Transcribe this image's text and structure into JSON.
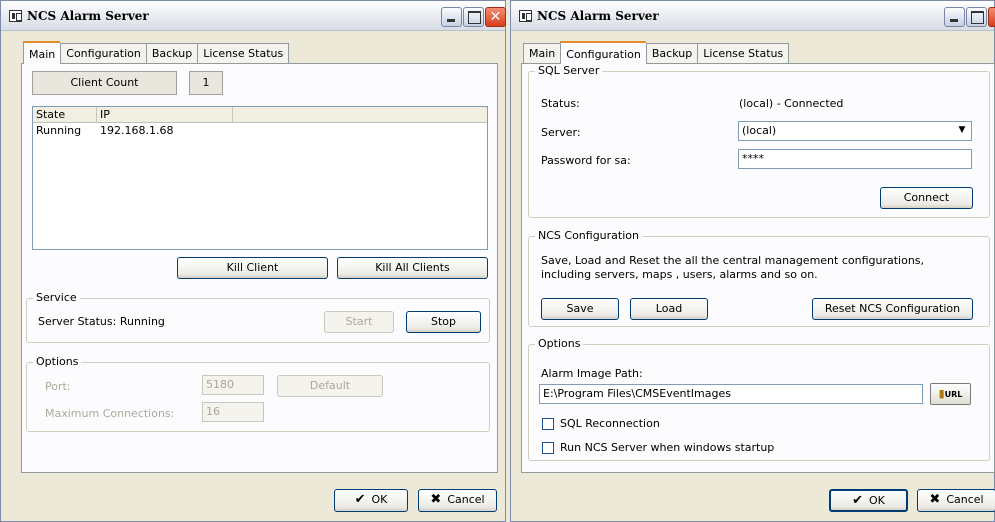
{
  "left_window": {
    "title": "NCS Alarm Server",
    "tabs": [
      "Main",
      "Configuration",
      "Backup",
      "License Status"
    ],
    "client_count_label": "Client Count",
    "client_count_value": "1",
    "list_headers": [
      "State",
      "IP"
    ],
    "list_rows": [
      [
        "Running",
        "192.168.1.68"
      ]
    ],
    "kill_client": "Kill Client",
    "kill_all_clients": "Kill All Clients",
    "service_legend": "Service",
    "server_status": "Server Status: Running",
    "start": "Start",
    "stop": "Stop",
    "options_legend": "Options",
    "port_label": "Port:",
    "port_value": "5180",
    "default": "Default",
    "max_conn_label": "Maximum Connections:",
    "max_conn_value": "16",
    "ok": "OK",
    "cancel": "Cancel"
  },
  "right_window": {
    "title": "NCS Alarm Server",
    "tabs": [
      "Main",
      "Configuration",
      "Backup",
      "License Status"
    ],
    "sql_legend": "SQL Server",
    "status_label": "Status:",
    "status_value": "(local) - Connected",
    "server_label": "Server:",
    "server_value": "(local)",
    "password_label": "Password for sa:",
    "password_value": "****",
    "connect": "Connect",
    "ncs_legend": "NCS Configuration",
    "ncs_desc": "Save, Load and Reset the all the central management configurations, including servers, maps , users, alarms and so on.",
    "save": "Save",
    "load": "Load",
    "reset": "Reset NCS Configuration",
    "options_legend": "Options",
    "alarm_path_label": "Alarm Image Path:",
    "alarm_path_value": "E:\\Program Files\\CMSEventImages",
    "url_btn": "URL",
    "sql_reconnection": "SQL Reconnection",
    "run_ncs": "Run NCS Server when windows startup",
    "ok": "OK",
    "cancel": "Cancel"
  }
}
